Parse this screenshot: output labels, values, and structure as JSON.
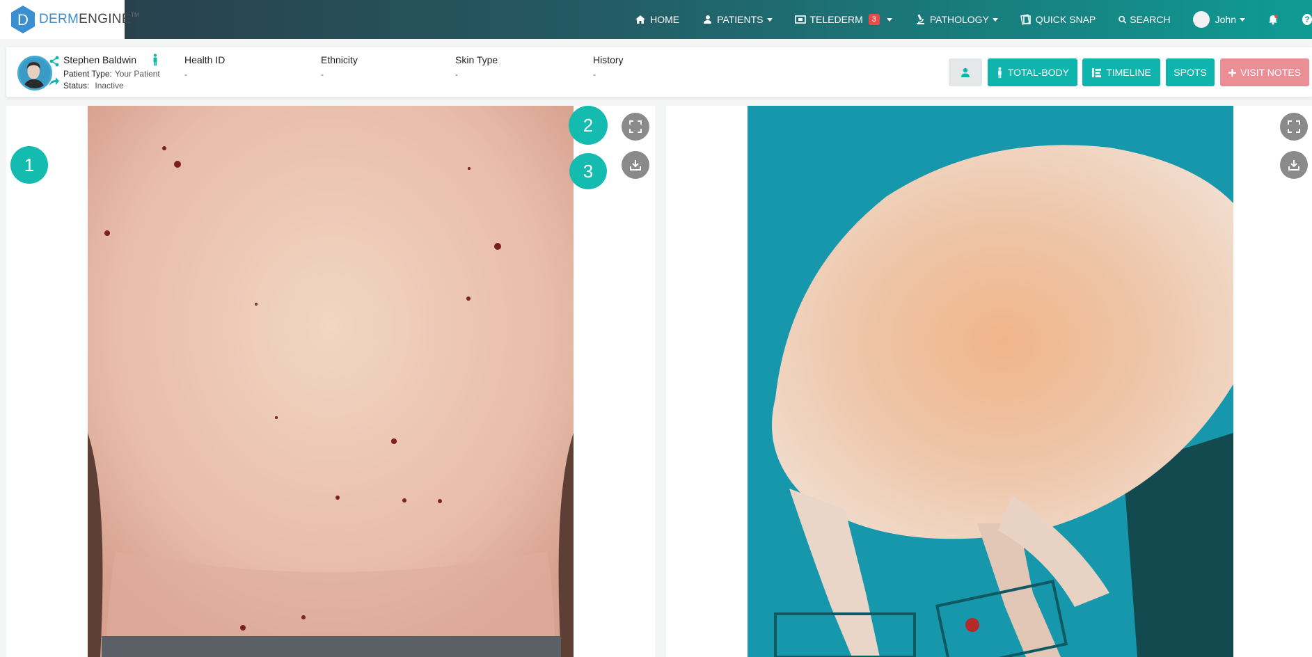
{
  "app": {
    "logo_text_bold": "DERM",
    "logo_text_rest": "ENGINE",
    "logo_tm": "TM",
    "logo_letter": "D"
  },
  "nav": {
    "home": "HOME",
    "patients": "PATIENTS",
    "telederm": "TELEDERM",
    "telederm_badge": "3",
    "pathology": "PATHOLOGY",
    "quick_snap": "QUICK SNAP",
    "search": "SEARCH",
    "user": "John",
    "help": "?"
  },
  "patient": {
    "name": "Stephen Baldwin",
    "type_label": "Patient Type:",
    "type_value": "Your Patient",
    "status_label": "Status:",
    "status_value": "Inactive",
    "fields": [
      {
        "label": "Health ID",
        "value": "-"
      },
      {
        "label": "Ethnicity",
        "value": "-"
      },
      {
        "label": "Skin Type",
        "value": "-"
      },
      {
        "label": "History",
        "value": "-"
      }
    ]
  },
  "actions": {
    "total_body": "TOTAL-BODY",
    "timeline": "TIMELINE",
    "spots": "SPOTS",
    "visit_notes": "VISIT NOTES"
  },
  "steps": [
    "1",
    "2",
    "3"
  ],
  "colors": {
    "accent": "#0fb5ac",
    "notes_button": "#eb8f97",
    "badge": "#e94b4b"
  }
}
